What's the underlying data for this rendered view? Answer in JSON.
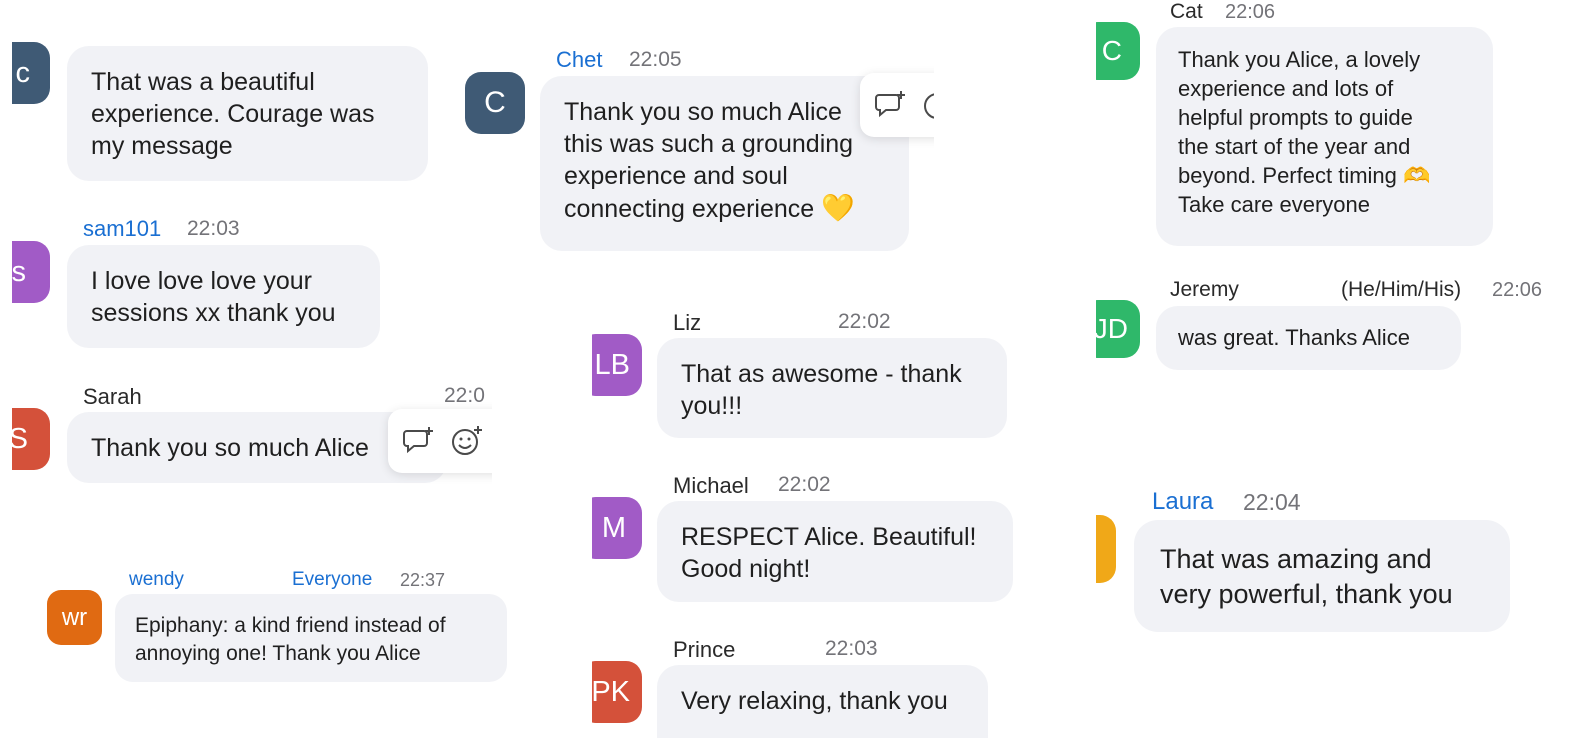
{
  "messages": {
    "c_top": {
      "avatar": "c",
      "text": "That was a beautiful\nexperience. Courage was\nmy message",
      "avatar_color": "#3f5a75"
    },
    "sam": {
      "avatar": "s",
      "name": "sam101",
      "time": "22:03",
      "text": "I love love love your\nsessions xx thank you",
      "avatar_color": "#a15bc6"
    },
    "sarah": {
      "avatar": "S",
      "name": "Sarah",
      "time": "22:0",
      "text": "Thank you so much Alice",
      "avatar_color": "#d4513a"
    },
    "wendy": {
      "avatar": "wr",
      "name": "wendy",
      "to": "Everyone",
      "time": "22:37",
      "text": "Epiphany: a kind friend instead of\nannoying one! Thank you Alice",
      "avatar_color": "#e06a12"
    },
    "chet": {
      "avatar": "C",
      "name": "Chet",
      "time": "22:05",
      "text": "Thank you so much Alice\nthis was such a grounding\nexperience and soul\nconnecting experience",
      "emoji": "💛",
      "avatar_color": "#3f5a75"
    },
    "liz": {
      "avatar": "LB",
      "name": "Liz",
      "time": "22:02",
      "text": "That as awesome - thank\nyou!!!",
      "avatar_color": "#a15bc6"
    },
    "michael": {
      "avatar": "M",
      "name": "Michael",
      "time": "22:02",
      "text": "RESPECT Alice. Beautiful!\nGood night!",
      "avatar_color": "#a15bc6"
    },
    "prince": {
      "avatar": "PK",
      "name": "Prince",
      "time": "22:03",
      "text": "Very relaxing, thank you",
      "avatar_color": "#d4513a"
    },
    "cat": {
      "avatar": "C",
      "name": "Cat",
      "time": "22:06",
      "text": "Thank you Alice, a lovely\nexperience and lots of\nhelpful prompts to guide\nthe start of the year and\nbeyond. Perfect timing",
      "emoji": "🫶",
      "text2": "Take care everyone",
      "avatar_color": "#2fb86a"
    },
    "jeremy": {
      "avatar": "JD",
      "name": "Jeremy",
      "pronouns": "(He/Him/His)",
      "time": "22:06",
      "text": "was great. Thanks Alice",
      "avatar_color": "#2fb86a"
    },
    "laura": {
      "avatar": "",
      "name": "Laura",
      "time": "22:04",
      "text": "That was amazing and\nvery powerful, thank you",
      "avatar_color": "#f0a818"
    }
  },
  "icons": {
    "reply": "reply-in-thread-icon",
    "reaction": "add-reaction-icon"
  }
}
